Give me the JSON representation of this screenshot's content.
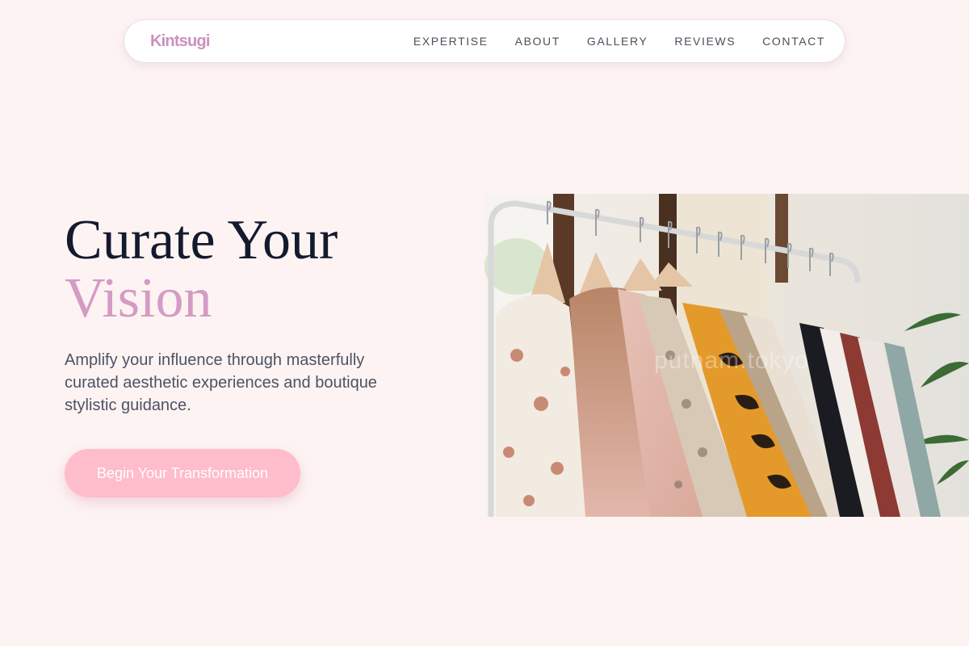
{
  "brand": {
    "logo_text": "Kintsugi",
    "accent_color": "#cc8fc0"
  },
  "nav": {
    "links": [
      "EXPERTISE",
      "ABOUT",
      "GALLERY",
      "REVIEWS",
      "CONTACT"
    ]
  },
  "hero": {
    "headline_line1": "Curate Your",
    "headline_line2": "Vision",
    "subtitle": "Amplify your influence through masterfully curated aesthetic experiences and boutique stylistic guidance.",
    "cta_label": "Begin Your Transformation",
    "image_watermark": "putnam.tokyo"
  },
  "colors": {
    "background": "#fdf3f3",
    "headline": "#141a2e",
    "headline_accent": "#d49bc4",
    "cta_background": "#ffbccb"
  }
}
